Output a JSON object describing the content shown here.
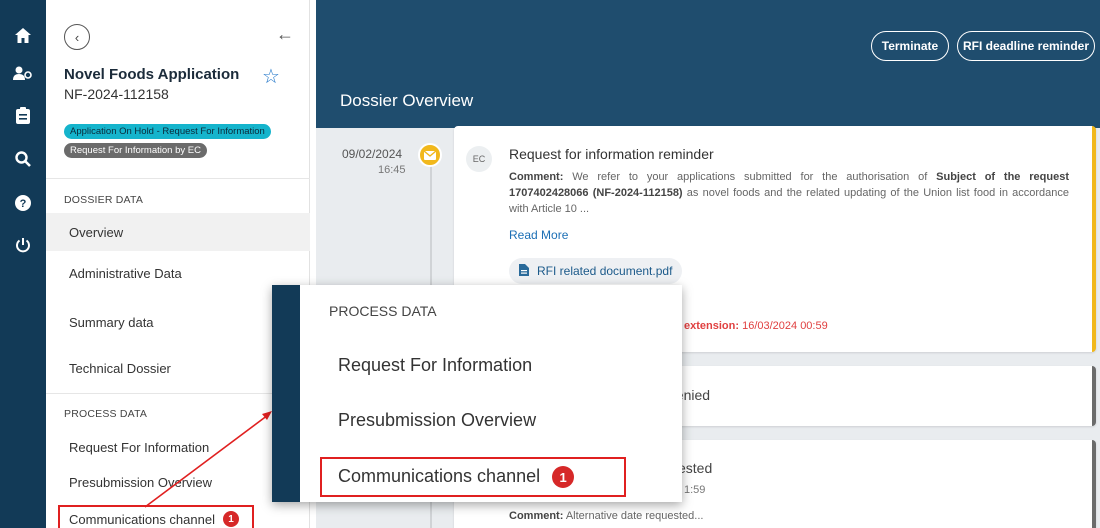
{
  "rail": {
    "icons": [
      "home-icon",
      "users-icon",
      "clipboard-icon",
      "search-icon",
      "help-icon",
      "power-icon"
    ]
  },
  "sidebar": {
    "title": "Novel Foods Application",
    "app_id": "NF-2024-112158",
    "status_badge": "Application On Hold - Request For Information",
    "rfi_badge": "Request For Information by EC",
    "dossier_section": "DOSSIER DATA",
    "dossier_items": [
      {
        "label": "Overview"
      },
      {
        "label": "Administrative Data"
      },
      {
        "label": "Summary data"
      },
      {
        "label": "Technical Dossier"
      }
    ],
    "process_section": "PROCESS DATA",
    "process_items": [
      {
        "label": "Request For Information"
      },
      {
        "label": "Presubmission Overview"
      },
      {
        "label": "Communications channel",
        "count": "1"
      }
    ]
  },
  "header": {
    "title": "Dossier Overview",
    "terminate_label": "Terminate",
    "rfi_reminder_label": "RFI deadline reminder"
  },
  "timeline": {
    "date": "09/02/2024",
    "time": "16:45",
    "card1": {
      "avatar": "EC",
      "title": "Request for information reminder",
      "comment_label": "Comment:",
      "comment_part1": "We refer to your applications submitted for the authorisation of",
      "comment_bold": "Subject of the request 1707402428066 (NF-2024-112158)",
      "comment_part2": "as novel foods and the related updating of the Union list food in accordance with Article 10 ...",
      "read_more": "Read More",
      "document": "RFI related document.pdf",
      "extension_label": "extension:",
      "extension_value": "16/03/2024 00:59"
    },
    "card2": {
      "text": "denied"
    },
    "card3": {
      "text": "ested",
      "time": "1:59",
      "comment_label": "Comment:",
      "comment": "Alternative date requested..."
    }
  },
  "zoom": {
    "section": "PROCESS DATA",
    "items": [
      {
        "label": "Request For Information"
      },
      {
        "label": "Presubmission Overview"
      },
      {
        "label": "Communications channel",
        "count": "1"
      }
    ]
  },
  "colors": {
    "rail": "#123a57",
    "header_band": "#1f4d6e",
    "accent_yellow": "#f1b81c",
    "badge_cyan": "#15b4cc",
    "highlight_red": "#e02020"
  }
}
